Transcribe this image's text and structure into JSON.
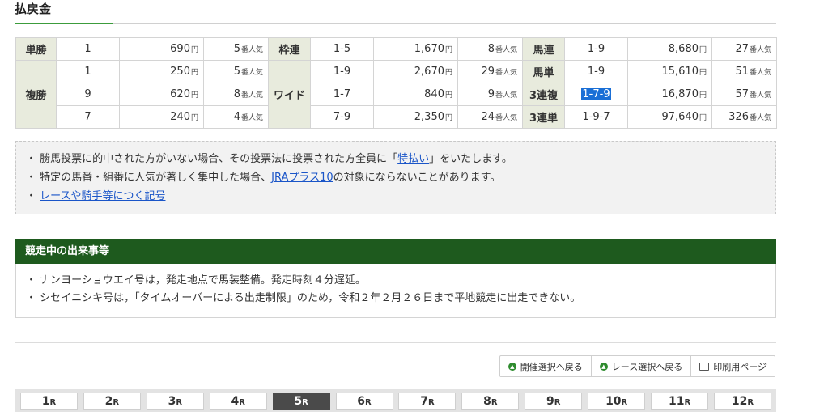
{
  "title": "払戻金",
  "unit_yen": "円",
  "unit_pop": "番人気",
  "tansho": {
    "label": "単勝",
    "rows": [
      {
        "num": "1",
        "amount": "690",
        "pop": "5"
      }
    ]
  },
  "fukusho": {
    "label": "複勝",
    "rows": [
      {
        "num": "1",
        "amount": "250",
        "pop": "5"
      },
      {
        "num": "9",
        "amount": "620",
        "pop": "8"
      },
      {
        "num": "7",
        "amount": "240",
        "pop": "4"
      }
    ]
  },
  "wakuren": {
    "label": "枠連",
    "rows": [
      {
        "num": "1-5",
        "amount": "1,670",
        "pop": "8"
      }
    ]
  },
  "wide": {
    "label": "ワイド",
    "rows": [
      {
        "num": "1-9",
        "amount": "2,670",
        "pop": "29"
      },
      {
        "num": "1-7",
        "amount": "840",
        "pop": "9"
      },
      {
        "num": "7-9",
        "amount": "2,350",
        "pop": "24"
      }
    ]
  },
  "umaren": {
    "label": "馬連",
    "rows": [
      {
        "num": "1-9",
        "amount": "8,680",
        "pop": "27"
      }
    ]
  },
  "umatan": {
    "label": "馬単",
    "rows": [
      {
        "num": "1-9",
        "amount": "15,610",
        "pop": "51"
      }
    ]
  },
  "sanrenpuku": {
    "label": "3連複",
    "rows": [
      {
        "num": "1-7-9",
        "amount": "16,870",
        "pop": "57"
      }
    ]
  },
  "sanrentan": {
    "label": "3連単",
    "rows": [
      {
        "num": "1-9-7",
        "amount": "97,640",
        "pop": "326"
      }
    ]
  },
  "notes": {
    "line1_pre": "・ 勝馬投票に的中された方がいない場合、その投票法に投票された方全員に「",
    "line1_link": "特払い",
    "line1_post": "」をいたします。",
    "line2_pre": "・ 特定の馬番・組番に人気が著しく集中した場合、",
    "line2_link": "JRAプラス10",
    "line2_post": "の対象にならないことがあります。",
    "line3_pre": "・ ",
    "line3_link": "レースや騎手等につく記号"
  },
  "events": {
    "title": "競走中の出来事等",
    "items": [
      "・ ナンヨーショウエイ号は，発走地点で馬装整備。発走時刻４分遅延。",
      "・ シセイニシキ号は，「タイムオーバーによる出走制限」のため，令和２年２月２６日まで平地競走に出走できない。"
    ]
  },
  "buttons": {
    "kaisai_back": "開催選択へ戻る",
    "race_back": "レース選択へ戻る",
    "print": "印刷用ページ"
  },
  "races": {
    "suffix": "R",
    "active": "5",
    "items": [
      "1",
      "2",
      "3",
      "4",
      "5",
      "6",
      "7",
      "8",
      "9",
      "10",
      "11",
      "12"
    ]
  }
}
